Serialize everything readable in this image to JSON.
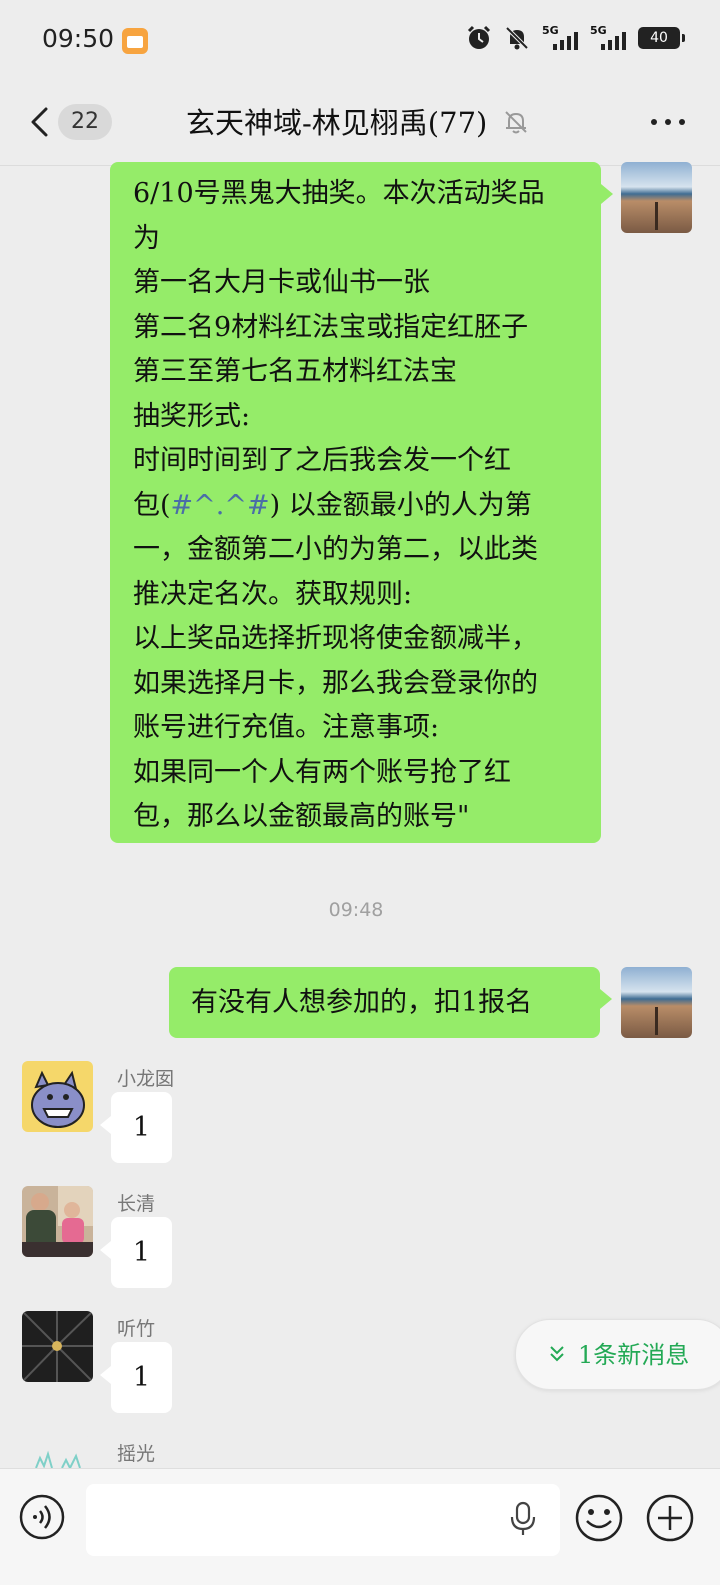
{
  "status_bar": {
    "time": "09:50",
    "signal1_label": "5G",
    "signal2_label": "5G",
    "battery": "40"
  },
  "header": {
    "unread_count": "22",
    "title": "玄天神域-林见栩禹(77)"
  },
  "messages": {
    "m1": {
      "sender": "self",
      "lines": [
        "6/10号黑鬼大抽奖。本次活动奖品",
        "为",
        "第一名大月卡或仙书一张",
        "第二名9材料红法宝或指定红胚子",
        "第三至第七名五材料红法宝",
        "抽奖形式:",
        "时间时间到了之后我会发一个红"
      ],
      "line8_prefix": "包(",
      "line8_emoji": "#^.^#",
      "line8_suffix": ") 以金额最小的人为第",
      "lines_after": [
        "一，金额第二小的为第二，以此类",
        "推决定名次。获取规则:",
        "以上奖品选择折现将使金额减半，",
        "如果选择月卡，那么我会登录你的",
        "账号进行充值。注意事项:",
        "如果同一个人有两个账号抢了红",
        "包，那么以金额最高的账号\""
      ]
    },
    "timestamp": "09:48",
    "m2": {
      "sender": "self",
      "text": "有没有人想参加的，扣1报名"
    },
    "m3": {
      "sender_name": "小龙囡",
      "text": "1"
    },
    "m4": {
      "sender_name": "长清",
      "text": "1"
    },
    "m5": {
      "sender_name": "听竹",
      "text": "1"
    },
    "m6": {
      "sender_name": "摇光"
    }
  },
  "new_messages_pill": {
    "label": "1条新消息"
  },
  "input_bar": {
    "placeholder": ""
  },
  "colors": {
    "self_bubble": "#95ec69",
    "other_bubble": "#ffffff",
    "background": "#ededed",
    "new_msg_text": "#23a955",
    "emoji_text": "#4a6ea7"
  }
}
